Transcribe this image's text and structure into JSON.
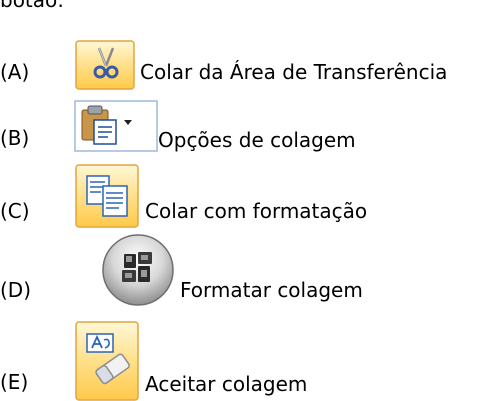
{
  "fragment_text": "botão:",
  "options": [
    {
      "letter": "(A)",
      "label": "Colar da Área de Transferência",
      "icon": "cut-scissors-icon"
    },
    {
      "letter": "(B)",
      "label": "Opções de colagem",
      "icon": "paste-options-icon"
    },
    {
      "letter": "(C)",
      "label": "Colar com formatação",
      "icon": "copy-documents-icon"
    },
    {
      "letter": "(D)",
      "label": "Formatar colagem",
      "icon": "office-button-icon"
    },
    {
      "letter": "(E)",
      "label": "Aceitar colagem",
      "icon": "clear-formatting-eraser-icon"
    }
  ]
}
